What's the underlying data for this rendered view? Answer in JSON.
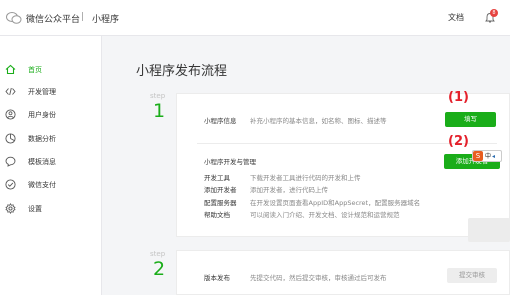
{
  "header": {
    "brand": "微信公众平台",
    "separator": "|",
    "product": "小程序",
    "docs_link": "文档",
    "notification_count": "8"
  },
  "sidebar": {
    "items": [
      {
        "label": "首页",
        "icon": "home-icon",
        "active": true
      },
      {
        "label": "开发管理",
        "icon": "code-icon",
        "active": false
      },
      {
        "label": "用户身份",
        "icon": "user-icon",
        "active": false
      },
      {
        "label": "数据分析",
        "icon": "analytics-icon",
        "active": false
      },
      {
        "label": "模板消息",
        "icon": "message-icon",
        "active": false
      },
      {
        "label": "微信支付",
        "icon": "pay-icon",
        "active": false
      },
      {
        "label": "设置",
        "icon": "gear-icon",
        "active": false
      }
    ]
  },
  "main": {
    "title": "小程序发布流程",
    "steps": [
      {
        "label": "step",
        "number": "1"
      },
      {
        "label": "step",
        "number": "2"
      }
    ],
    "step1": {
      "info_title": "小程序信息",
      "info_desc": "补充小程序的基本信息，如名称、图标、描述等",
      "info_button": "填写",
      "dev_title": "小程序开发与管理",
      "dev_button": "添加开发者",
      "dev_rows": [
        {
          "key": "开发工具",
          "value": "下载开发者工具进行代码的开发和上传"
        },
        {
          "key": "添加开发者",
          "value": "添加开发者，进行代码上传"
        },
        {
          "key": "配置服务器",
          "value": "在开发设置页面查看AppID和AppSecret，配置服务器域名"
        },
        {
          "key": "帮助文档",
          "value": "可以阅读入门介绍、开发文档、设计规范和运营规范"
        }
      ]
    },
    "step2": {
      "title": "版本发布",
      "desc": "先提交代码，然后提交审核，审核通过后可发布",
      "button": "提交审核"
    }
  },
  "annotations": {
    "first": "(1)",
    "second": "(2)"
  },
  "ime": {
    "s": "S",
    "mode": "中",
    "arrow": "◂"
  },
  "colors": {
    "accent": "#1aad19",
    "annotation": "#e4202b",
    "badge": "#e64340"
  }
}
